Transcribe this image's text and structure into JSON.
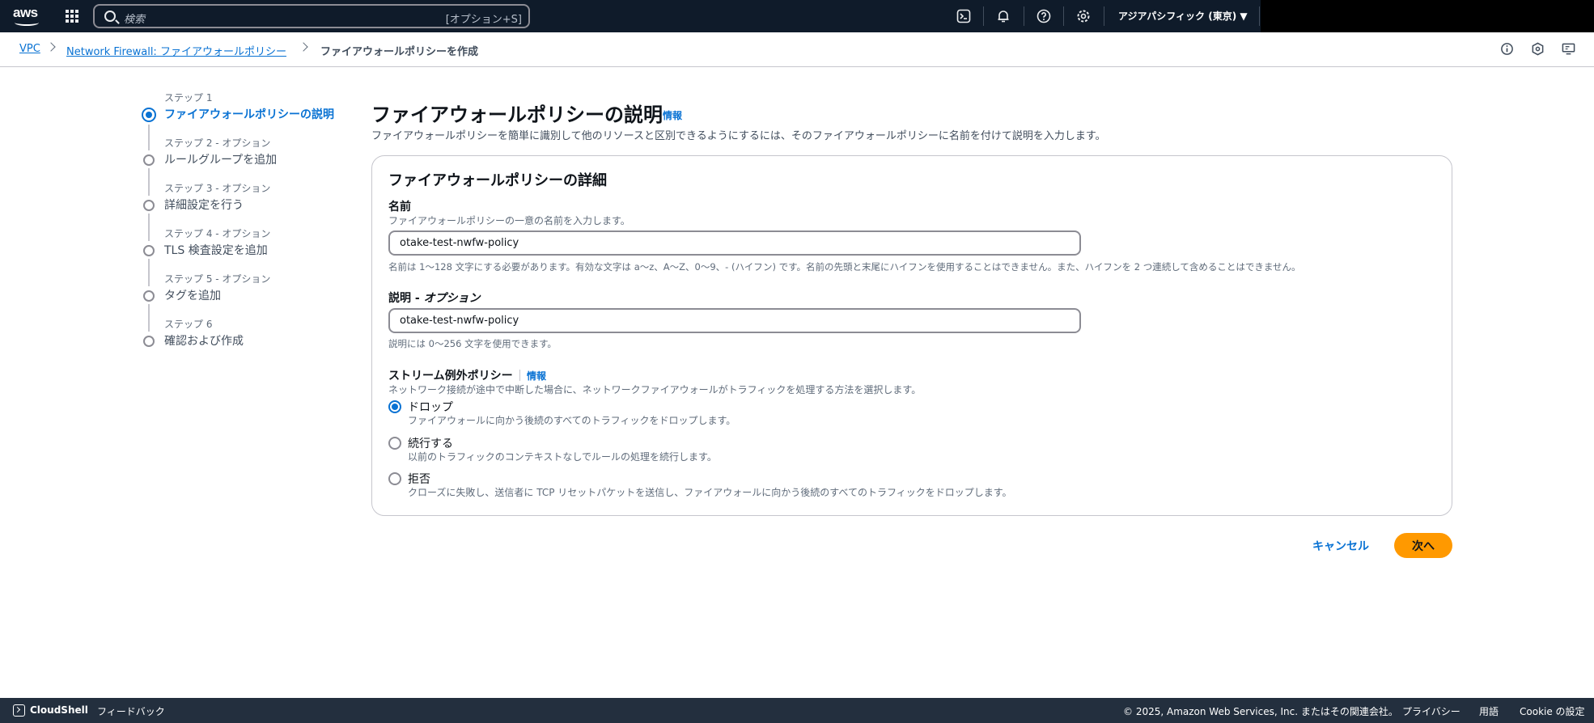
{
  "topnav": {
    "logo": "aws",
    "search_placeholder": "検索",
    "search_shortcut": "[オプション+S]",
    "region": "アジアパシフィック (東京) ▼",
    "icons": [
      "cloudshell-icon",
      "bell-icon",
      "help-icon",
      "gear-icon"
    ]
  },
  "breadcrumb": {
    "items": [
      "VPC",
      "Network Firewall: ファイアウォールポリシー",
      "ファイアウォールポリシーを作成"
    ]
  },
  "steps": [
    {
      "label": "ステップ 1",
      "name": "ファイアウォールポリシーの説明",
      "active": true
    },
    {
      "label": "ステップ 2 - オプション",
      "name": "ルールグループを追加",
      "active": false
    },
    {
      "label": "ステップ 3 - オプション",
      "name": "詳細設定を行う",
      "active": false
    },
    {
      "label": "ステップ 4 - オプション",
      "name": "TLS 検査設定を追加",
      "active": false
    },
    {
      "label": "ステップ 5 - オプション",
      "name": "タグを追加",
      "active": false
    },
    {
      "label": "ステップ 6",
      "name": "確認および作成",
      "active": false
    }
  ],
  "main": {
    "title": "ファイアウォールポリシーの説明",
    "info": "情報",
    "subtitle": "ファイアウォールポリシーを簡単に識別して他のリソースと区別できるようにするには、そのファイアウォールポリシーに名前を付けて説明を入力します。"
  },
  "panel": {
    "heading": "ファイアウォールポリシーの詳細",
    "name_label": "名前",
    "name_desc": "ファイアウォールポリシーの一意の名前を入力します。",
    "name_value": "otake-test-nwfw-policy",
    "name_hint": "名前は 1〜128 文字にする必要があります。有効な文字は a〜z、A〜Z、0〜9、- (ハイフン) です。名前の先頭と末尾にハイフンを使用することはできません。また、ハイフンを 2 つ連続して含めることはできません。",
    "desc_label": "説明 - ",
    "desc_label_optional": "オプション",
    "desc_value": "otake-test-nwfw-policy",
    "desc_hint": "説明には 0〜256 文字を使用できます。",
    "stream_label": "ストリーム例外ポリシー",
    "stream_info": "情報",
    "stream_desc": "ネットワーク接続が途中で中断した場合に、ネットワークファイアウォールがトラフィックを処理する方法を選択します。",
    "options": [
      {
        "label": "ドロップ",
        "desc": "ファイアウォールに向かう後続のすべてのトラフィックをドロップします。",
        "selected": true
      },
      {
        "label": "続行する",
        "desc": "以前のトラフィックのコンテキストなしでルールの処理を続行します。",
        "selected": false
      },
      {
        "label": "拒否",
        "desc": "クローズに失敗し、送信者に TCP リセットパケットを送信し、ファイアウォールに向かう後続のすべてのトラフィックをドロップします。",
        "selected": false
      }
    ]
  },
  "actions": {
    "cancel": "キャンセル",
    "next": "次へ"
  },
  "footer": {
    "cloudshell": "CloudShell",
    "feedback": "フィードバック",
    "copyright": "© 2025, Amazon Web Services, Inc. またはその関連会社。",
    "privacy": "プライバシー",
    "terms": "用語",
    "cookie": "Cookie の設定"
  },
  "colors": {
    "accent": "#0972d3",
    "primary_button": "#ff9900",
    "topnav": "#0f1b2a",
    "footer": "#232f3e"
  }
}
